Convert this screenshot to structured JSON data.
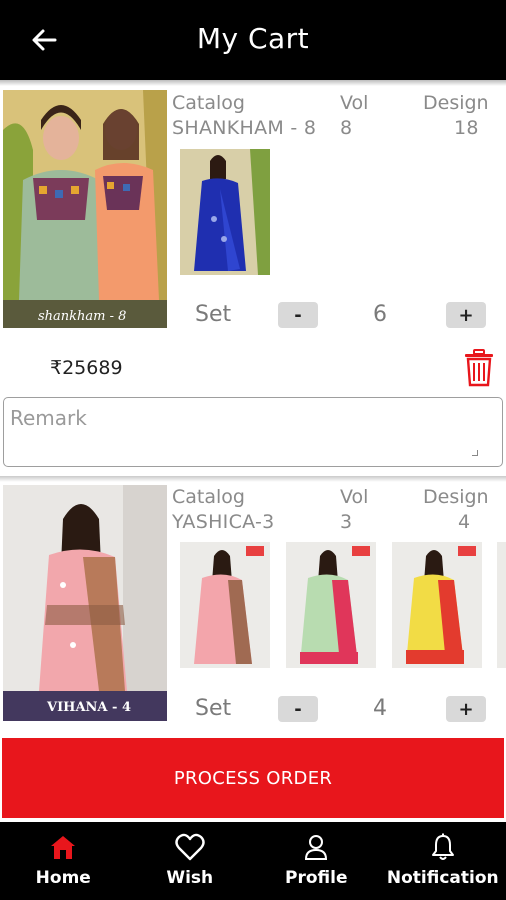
{
  "header": {
    "title": "My Cart",
    "back_icon": "arrow-left-icon"
  },
  "labels": {
    "catalog": "Catalog",
    "vol": "Vol",
    "design": "Design",
    "set": "Set",
    "minus": "-",
    "plus": "+",
    "remark_placeholder": "Remark"
  },
  "cart_items": [
    {
      "catalog": "SHANKHAM - 8",
      "vol": "8",
      "design": "18",
      "set_qty": "6",
      "price": "₹25689",
      "cover_caption": "shankham - 8"
    },
    {
      "catalog": "YASHICA-3",
      "vol": "3",
      "design": "4",
      "set_qty": "4",
      "cover_caption": "VIHANA - 4"
    }
  ],
  "actions": {
    "process_order": "PROCESS ORDER"
  },
  "bottom_nav": [
    {
      "label": "Home",
      "icon": "home-icon",
      "active": true
    },
    {
      "label": "Wish",
      "icon": "heart-icon",
      "active": false
    },
    {
      "label": "Profile",
      "icon": "user-icon",
      "active": false
    },
    {
      "label": "Notification",
      "icon": "bell-icon",
      "active": false
    }
  ],
  "colors": {
    "accent": "#e8161c",
    "header_bg": "#000000",
    "active_nav": "#e8161c"
  }
}
